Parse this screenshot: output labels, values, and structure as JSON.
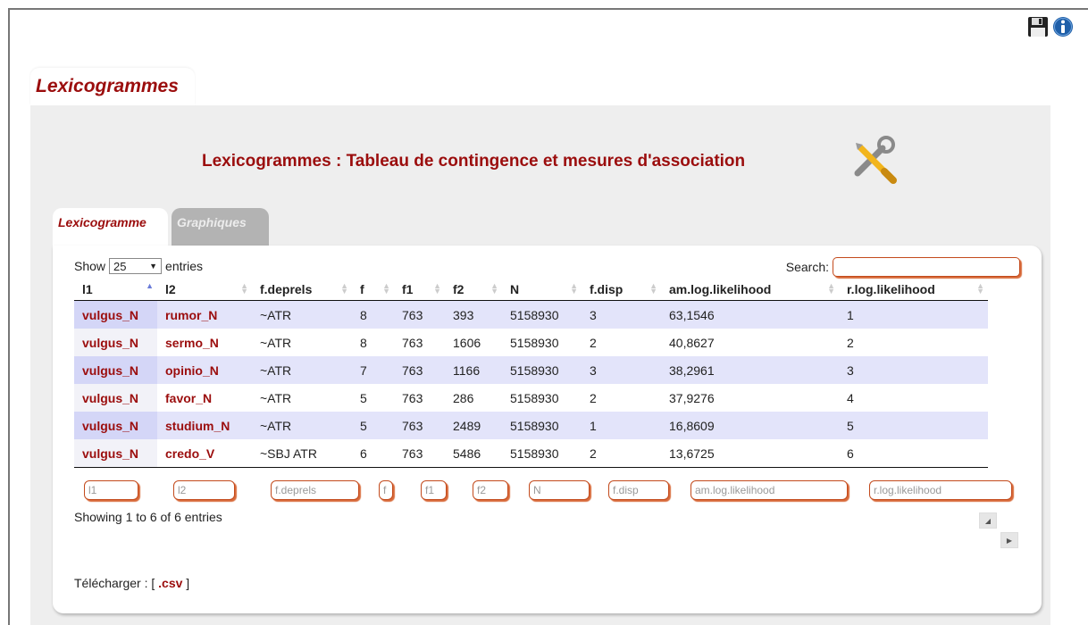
{
  "outer_tab": "Lexicogrammes",
  "main_title": "Lexicogrammes : Tableau de contingence et mesures d'association",
  "tabs": [
    "Lexicogramme",
    "Graphiques"
  ],
  "controls": {
    "show_label": "Show",
    "entries_value": "25",
    "entries_label": "entries",
    "search_label": "Search:"
  },
  "columns": [
    "l1",
    "l2",
    "f.deprels",
    "f",
    "f1",
    "f2",
    "N",
    "f.disp",
    "am.log.likelihood",
    "r.log.likelihood"
  ],
  "rows": [
    [
      "vulgus_N",
      "rumor_N",
      "~ATR",
      "8",
      "763",
      "393",
      "5158930",
      "3",
      "63,1546",
      "1"
    ],
    [
      "vulgus_N",
      "sermo_N",
      "~ATR",
      "8",
      "763",
      "1606",
      "5158930",
      "2",
      "40,8627",
      "2"
    ],
    [
      "vulgus_N",
      "opinio_N",
      "~ATR",
      "7",
      "763",
      "1166",
      "5158930",
      "3",
      "38,2961",
      "3"
    ],
    [
      "vulgus_N",
      "favor_N",
      "~ATR",
      "5",
      "763",
      "286",
      "5158930",
      "2",
      "37,9276",
      "4"
    ],
    [
      "vulgus_N",
      "studium_N",
      "~ATR",
      "5",
      "763",
      "2489",
      "5158930",
      "1",
      "16,8609",
      "5"
    ],
    [
      "vulgus_N",
      "credo_V",
      "~SBJ ATR",
      "6",
      "763",
      "5486",
      "5158930",
      "2",
      "13,6725",
      "6"
    ]
  ],
  "filters": [
    "l1",
    "l2",
    "f.deprels",
    "f",
    "f1",
    "f2",
    "N",
    "f.disp",
    "am.log.likelihood",
    "r.log.likelihood"
  ],
  "info": "Showing 1 to 6 of 6 entries",
  "download": {
    "label": "Télécharger :",
    "open": "[",
    "link": ".csv",
    "close": "]"
  },
  "icons": [
    "save-icon",
    "info-icon",
    "tools-icon",
    "prev-page-icon",
    "next-page-icon"
  ],
  "colors": {
    "accent": "#9b0d0d",
    "row_highlight": "#e3e4fa",
    "input_border": "#c34a1c",
    "panel_bg": "#eeeeee"
  }
}
